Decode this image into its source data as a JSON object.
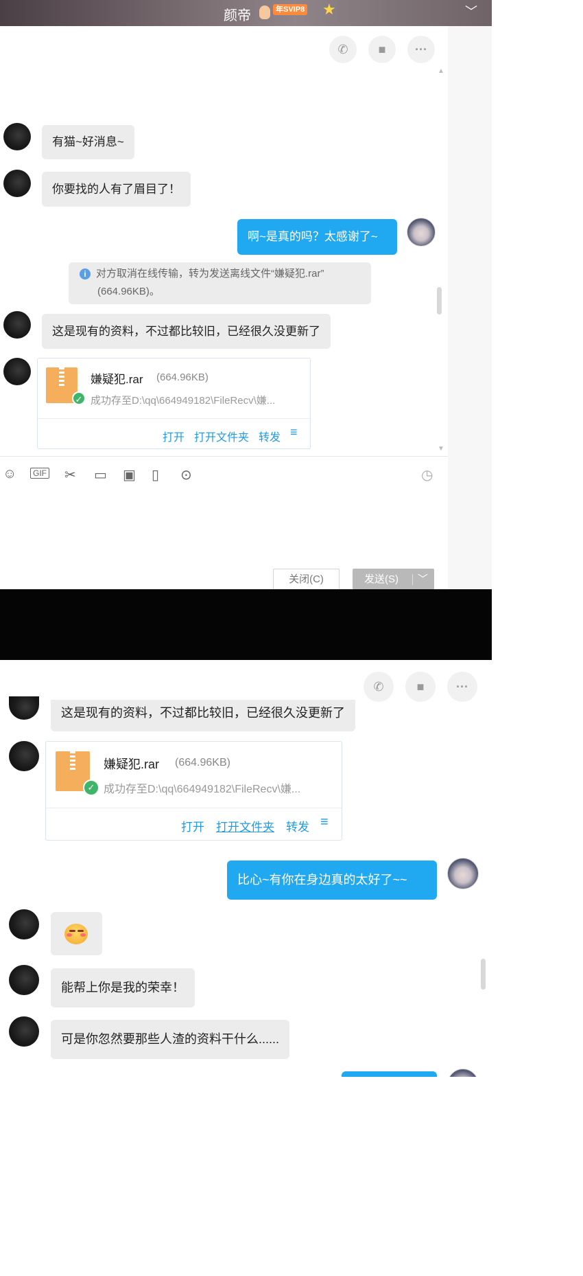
{
  "header": {
    "contact_name": "颜帝",
    "vip_badge": "年SVIP8",
    "star_icon": "star-icon",
    "collapse_icon": "chevron-down-icon"
  },
  "toolbar_top": [
    "phone-icon",
    "video-icon",
    "more-icon"
  ],
  "panel1": {
    "messages": [
      {
        "from": "them",
        "text": "有猫~好消息~"
      },
      {
        "from": "them",
        "text": "你要找的人有了眉目了！"
      },
      {
        "from": "me",
        "text": "啊~是真的吗？太感谢了~"
      }
    ],
    "system_notice": {
      "line1": "对方取消在线传输，转为发送离线文件“嫌疑犯.rar”",
      "line2": "(664.96KB)。"
    },
    "message_after_notice": {
      "from": "them",
      "text": "这是现有的资料，不过都比较旧，已经很久没更新了"
    },
    "file": {
      "name": "嫌疑犯.rar",
      "size": "(664.96KB)",
      "status": "成功存至D:\\qq\\664949182\\FileRecv\\嫌...",
      "actions": [
        "打开",
        "打开文件夹",
        "转发"
      ]
    },
    "input_toolbar": [
      "smile-icon",
      "gif-icon",
      "scissors-icon",
      "folder-icon",
      "image-icon",
      "shake-icon",
      "more-circle-icon",
      "history-clock-icon"
    ],
    "close_button": "关闭(C)",
    "send_button": "发送(S)"
  },
  "panel2": {
    "partial_message": "这是现有的资料，不过都比较旧，已经很久没更新了",
    "file": {
      "name": "嫌疑犯.rar",
      "size": "(664.96KB)",
      "status": "成功存至D:\\qq\\664949182\\FileRecv\\嫌...",
      "actions": [
        "打开",
        "打开文件夹",
        "转发"
      ]
    },
    "messages": [
      {
        "from": "me",
        "text": "比心~有你在身边真的太好了~~"
      },
      {
        "from": "them",
        "emoji": "blushing-face-emoji"
      },
      {
        "from": "them",
        "text": "能帮上你是我的荣幸！"
      },
      {
        "from": "them",
        "text": "可是你忽然要那些人渣的资料干什么......"
      }
    ]
  }
}
